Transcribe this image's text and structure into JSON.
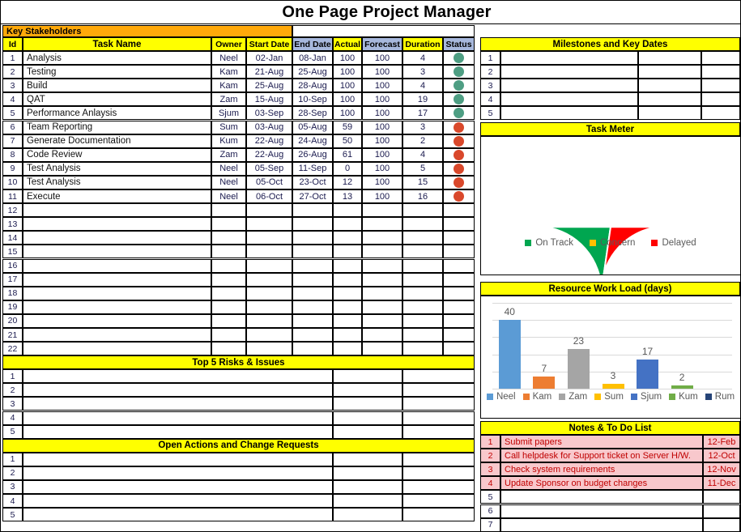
{
  "title": "One Page Project Manager",
  "left_panel": {
    "stakeholders_label": "Key Stakeholders",
    "columns": [
      "Id",
      "Task Name",
      "Owner",
      "Start Date",
      "End Date",
      "Actual",
      "Forecast",
      "Duration",
      "Status"
    ],
    "tasks": [
      {
        "id": "1",
        "name": "Analysis",
        "owner": "Neel",
        "start": "02-Jan",
        "end": "08-Jan",
        "actual": "100",
        "forecast": "100",
        "duration": "4",
        "status": "green"
      },
      {
        "id": "2",
        "name": "Testing",
        "owner": "Kam",
        "start": "21-Aug",
        "end": "25-Aug",
        "actual": "100",
        "forecast": "100",
        "duration": "3",
        "status": "green"
      },
      {
        "id": "3",
        "name": "Build",
        "owner": "Kam",
        "start": "25-Aug",
        "end": "28-Aug",
        "actual": "100",
        "forecast": "100",
        "duration": "4",
        "status": "green"
      },
      {
        "id": "4",
        "name": "QAT",
        "owner": "Zam",
        "start": "15-Aug",
        "end": "10-Sep",
        "actual": "100",
        "forecast": "100",
        "duration": "19",
        "status": "green"
      },
      {
        "id": "5",
        "name": "Performance Anlaysis",
        "owner": "Sjum",
        "start": "03-Sep",
        "end": "28-Sep",
        "actual": "100",
        "forecast": "100",
        "duration": "17",
        "status": "green"
      },
      {
        "id": "6",
        "name": "Team Reporting",
        "owner": "Sum",
        "start": "03-Aug",
        "end": "05-Aug",
        "actual": "59",
        "forecast": "100",
        "duration": "3",
        "status": "red"
      },
      {
        "id": "7",
        "name": "Generate Documentation",
        "owner": "Kum",
        "start": "22-Aug",
        "end": "24-Aug",
        "actual": "50",
        "forecast": "100",
        "duration": "2",
        "status": "red"
      },
      {
        "id": "8",
        "name": "Code Review",
        "owner": "Zam",
        "start": "22-Aug",
        "end": "26-Aug",
        "actual": "61",
        "forecast": "100",
        "duration": "4",
        "status": "red"
      },
      {
        "id": "9",
        "name": "Test Analysis",
        "owner": "Neel",
        "start": "05-Sep",
        "end": "11-Sep",
        "actual": "0",
        "forecast": "100",
        "duration": "5",
        "status": "red"
      },
      {
        "id": "10",
        "name": "Test Analysis",
        "owner": "Neel",
        "start": "05-Oct",
        "end": "23-Oct",
        "actual": "12",
        "forecast": "100",
        "duration": "15",
        "status": "red"
      },
      {
        "id": "11",
        "name": "Execute",
        "owner": "Neel",
        "start": "06-Oct",
        "end": "27-Oct",
        "actual": "13",
        "forecast": "100",
        "duration": "16",
        "status": "red"
      },
      {
        "id": "12",
        "name": "",
        "owner": "",
        "start": "",
        "end": "",
        "actual": "",
        "forecast": "",
        "duration": "",
        "status": ""
      },
      {
        "id": "13",
        "name": "",
        "owner": "",
        "start": "",
        "end": "",
        "actual": "",
        "forecast": "",
        "duration": "",
        "status": ""
      },
      {
        "id": "14",
        "name": "",
        "owner": "",
        "start": "",
        "end": "",
        "actual": "",
        "forecast": "",
        "duration": "",
        "status": ""
      },
      {
        "id": "15",
        "name": "",
        "owner": "",
        "start": "",
        "end": "",
        "actual": "",
        "forecast": "",
        "duration": "",
        "status": ""
      },
      {
        "id": "16",
        "name": "",
        "owner": "",
        "start": "",
        "end": "",
        "actual": "",
        "forecast": "",
        "duration": "",
        "status": ""
      },
      {
        "id": "17",
        "name": "",
        "owner": "",
        "start": "",
        "end": "",
        "actual": "",
        "forecast": "",
        "duration": "",
        "status": ""
      },
      {
        "id": "18",
        "name": "",
        "owner": "",
        "start": "",
        "end": "",
        "actual": "",
        "forecast": "",
        "duration": "",
        "status": ""
      },
      {
        "id": "19",
        "name": "",
        "owner": "",
        "start": "",
        "end": "",
        "actual": "",
        "forecast": "",
        "duration": "",
        "status": ""
      },
      {
        "id": "20",
        "name": "",
        "owner": "",
        "start": "",
        "end": "",
        "actual": "",
        "forecast": "",
        "duration": "",
        "status": ""
      },
      {
        "id": "21",
        "name": "",
        "owner": "",
        "start": "",
        "end": "",
        "actual": "",
        "forecast": "",
        "duration": "",
        "status": ""
      },
      {
        "id": "22",
        "name": "",
        "owner": "",
        "start": "",
        "end": "",
        "actual": "",
        "forecast": "",
        "duration": "",
        "status": ""
      }
    ],
    "risks": {
      "header": "Top 5 Risks & Issues",
      "rows": [
        {
          "id": "1",
          "text": "",
          "col2": "",
          "col3": ""
        },
        {
          "id": "2",
          "text": "",
          "col2": "",
          "col3": ""
        },
        {
          "id": "3",
          "text": "",
          "col2": "",
          "col3": ""
        },
        {
          "id": "4",
          "text": "",
          "col2": "",
          "col3": ""
        },
        {
          "id": "5",
          "text": "",
          "col2": "",
          "col3": ""
        }
      ]
    },
    "open_actions": {
      "header": "Open Actions and Change Requests",
      "rows": [
        {
          "id": "1",
          "text": "",
          "col2": "",
          "col3": ""
        },
        {
          "id": "2",
          "text": "",
          "col2": "",
          "col3": ""
        },
        {
          "id": "3",
          "text": "",
          "col2": "",
          "col3": ""
        },
        {
          "id": "4",
          "text": "",
          "col2": "",
          "col3": ""
        },
        {
          "id": "5",
          "text": "",
          "col2": "",
          "col3": ""
        }
      ]
    }
  },
  "right_panel": {
    "milestones": {
      "header": "Milestones and Key Dates",
      "rows": [
        {
          "id": "1",
          "text": "",
          "col2": "",
          "col3": ""
        },
        {
          "id": "2",
          "text": "",
          "col2": "",
          "col3": ""
        },
        {
          "id": "3",
          "text": "",
          "col2": "",
          "col3": ""
        },
        {
          "id": "4",
          "text": "",
          "col2": "",
          "col3": ""
        },
        {
          "id": "5",
          "text": "",
          "col2": "",
          "col3": ""
        }
      ]
    },
    "task_meter": {
      "header": "Task Meter"
    },
    "resource_load": {
      "header": "Resource Work Load (days)"
    },
    "notes": {
      "header": "Notes & To Do List",
      "rows": [
        {
          "id": "1",
          "text": "Submit papers",
          "date": "12-Feb",
          "filled": true
        },
        {
          "id": "2",
          "text": "Call helpdesk for Support ticket on Server H/W.",
          "date": "12-Oct",
          "filled": true
        },
        {
          "id": "3",
          "text": "Check system requirements",
          "date": "12-Nov",
          "filled": true
        },
        {
          "id": "4",
          "text": "Update Sponsor on budget changes",
          "date": "11-Dec",
          "filled": true
        },
        {
          "id": "5",
          "text": "",
          "date": "",
          "filled": false
        },
        {
          "id": "6",
          "text": "",
          "date": "",
          "filled": false
        },
        {
          "id": "7",
          "text": "",
          "date": "",
          "filled": false
        }
      ]
    }
  },
  "chart_data": [
    {
      "type": "pie",
      "title": "Task Meter",
      "variant": "half-donut-gauge",
      "labels": [
        "On Track",
        "Concern",
        "Delayed"
      ],
      "values": [
        5,
        0,
        6
      ],
      "colors": [
        "#00A650",
        "#FFC000",
        "#FF0000"
      ],
      "legend_position": "bottom"
    },
    {
      "type": "bar",
      "title": "Resource Work Load (days)",
      "categories": [
        "Neel",
        "Kam",
        "Zam",
        "Sum",
        "Sjum",
        "Kum",
        "Rum"
      ],
      "values": [
        40,
        7,
        23,
        3,
        17,
        2,
        0
      ],
      "colors": [
        "#5B9BD5",
        "#ED7D31",
        "#A5A5A5",
        "#FFC000",
        "#4472C4",
        "#70AD47",
        "#264478"
      ],
      "xlabel": "",
      "ylabel": "",
      "ylim": [
        0,
        50
      ],
      "grid": true,
      "data_labels": true,
      "legend_position": "bottom"
    }
  ]
}
